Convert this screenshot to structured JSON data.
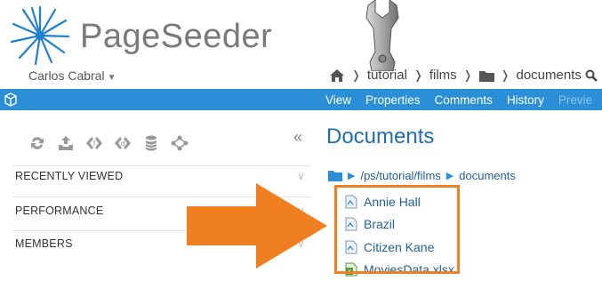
{
  "app": {
    "logo_text": "PageSeeder",
    "user_name": "Carlos Cabral"
  },
  "breadcrumb": [
    "tutorial",
    "films",
    "documents"
  ],
  "tabs": [
    {
      "label": "View",
      "active": true
    },
    {
      "label": "Properties",
      "active": true
    },
    {
      "label": "Comments",
      "active": true
    },
    {
      "label": "History",
      "active": true
    },
    {
      "label": "Previe",
      "active": false
    }
  ],
  "sidebar": {
    "tool_icons": [
      "refresh-icon",
      "inbox-upload-icon",
      "code-diamond-icon",
      "code-d-icon",
      "database-icon",
      "flow-icon"
    ],
    "sections": [
      "RECENTLY VIEWED",
      "PERFORMANCE",
      "MEMBERS"
    ]
  },
  "main": {
    "title": "Documents",
    "path_root": "/ps/tutorial/films",
    "path_current": "documents",
    "files": [
      {
        "name": "Annie Hall",
        "type": "document"
      },
      {
        "name": "Brazil",
        "type": "document"
      },
      {
        "name": "Citizen Kane",
        "type": "document"
      },
      {
        "name": "MoviesData.xlsx",
        "type": "spreadsheet"
      }
    ]
  },
  "colors": {
    "accent_bar": "#2a8fd6",
    "highlight": "#f07f22",
    "link": "#1f5f9c"
  }
}
